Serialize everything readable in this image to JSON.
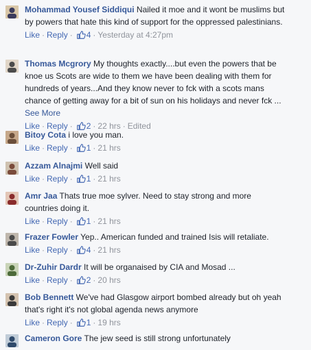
{
  "comments": [
    {
      "name": "Mohammad Yousef Siddiqui",
      "text": "Nailed it moe and it wont be muslims but by powers that hate this kind of support for the oppressed palestinians.",
      "like": "Like",
      "reply": "Reply",
      "likes": "4",
      "time": "Yesterday at 4:27pm",
      "edited": "",
      "see_more": ""
    },
    {
      "name": "Thomas Mcgrory",
      "text": "My thoughts exactly....but even the powers that be knoe us Scots are wide to them we have been dealing with them for hundreds of years...And they know never to fck with a scots mans chance of getting away for a bit of sun on his holidays and never fck ...",
      "like": "Like",
      "reply": "Reply",
      "likes": "2",
      "time": "22 hrs",
      "edited": "Edited",
      "see_more": "See More"
    },
    {
      "name": "Bitoy Cota",
      "text": "i love you man.",
      "like": "Like",
      "reply": "Reply",
      "likes": "1",
      "time": "21 hrs",
      "edited": "",
      "see_more": ""
    },
    {
      "name": "Azzam Alnajmi",
      "text": "Well said",
      "like": "Like",
      "reply": "Reply",
      "likes": "1",
      "time": "21 hrs",
      "edited": "",
      "see_more": ""
    },
    {
      "name": "Amr Jaa",
      "text": "Thats true moe sylver. Need to stay strong and more countries doing it.",
      "like": "Like",
      "reply": "Reply",
      "likes": "1",
      "time": "21 hrs",
      "edited": "",
      "see_more": ""
    },
    {
      "name": "Frazer Fowler",
      "text": "Yep.. American funded and trained Isis will retaliate.",
      "like": "Like",
      "reply": "Reply",
      "likes": "4",
      "time": "21 hrs",
      "edited": "",
      "see_more": ""
    },
    {
      "name": "Dr-Zuhir Dardr",
      "text": "It will be organaised by CIA and Mosad ...",
      "like": "Like",
      "reply": "Reply",
      "likes": "2",
      "time": "20 hrs",
      "edited": "",
      "see_more": ""
    },
    {
      "name": "Bob Bennett",
      "text": "We've had Glasgow airport bombed already but oh yeah that's right it's not global agenda news anymore",
      "like": "Like",
      "reply": "Reply",
      "likes": "1",
      "time": "19 hrs",
      "edited": "",
      "see_more": ""
    },
    {
      "name": "Cameron Gore",
      "text": "The jew seed is still strong unfortunately",
      "like": "",
      "reply": "",
      "likes": "",
      "time": "",
      "edited": "",
      "see_more": ""
    }
  ],
  "colors": {
    "link": "#365899",
    "action": "#4267b2",
    "meta": "#90949c",
    "bg": "#f6f7f9"
  },
  "icons": {
    "avatar": "profile-picture",
    "like": "thumbs-up-icon"
  }
}
